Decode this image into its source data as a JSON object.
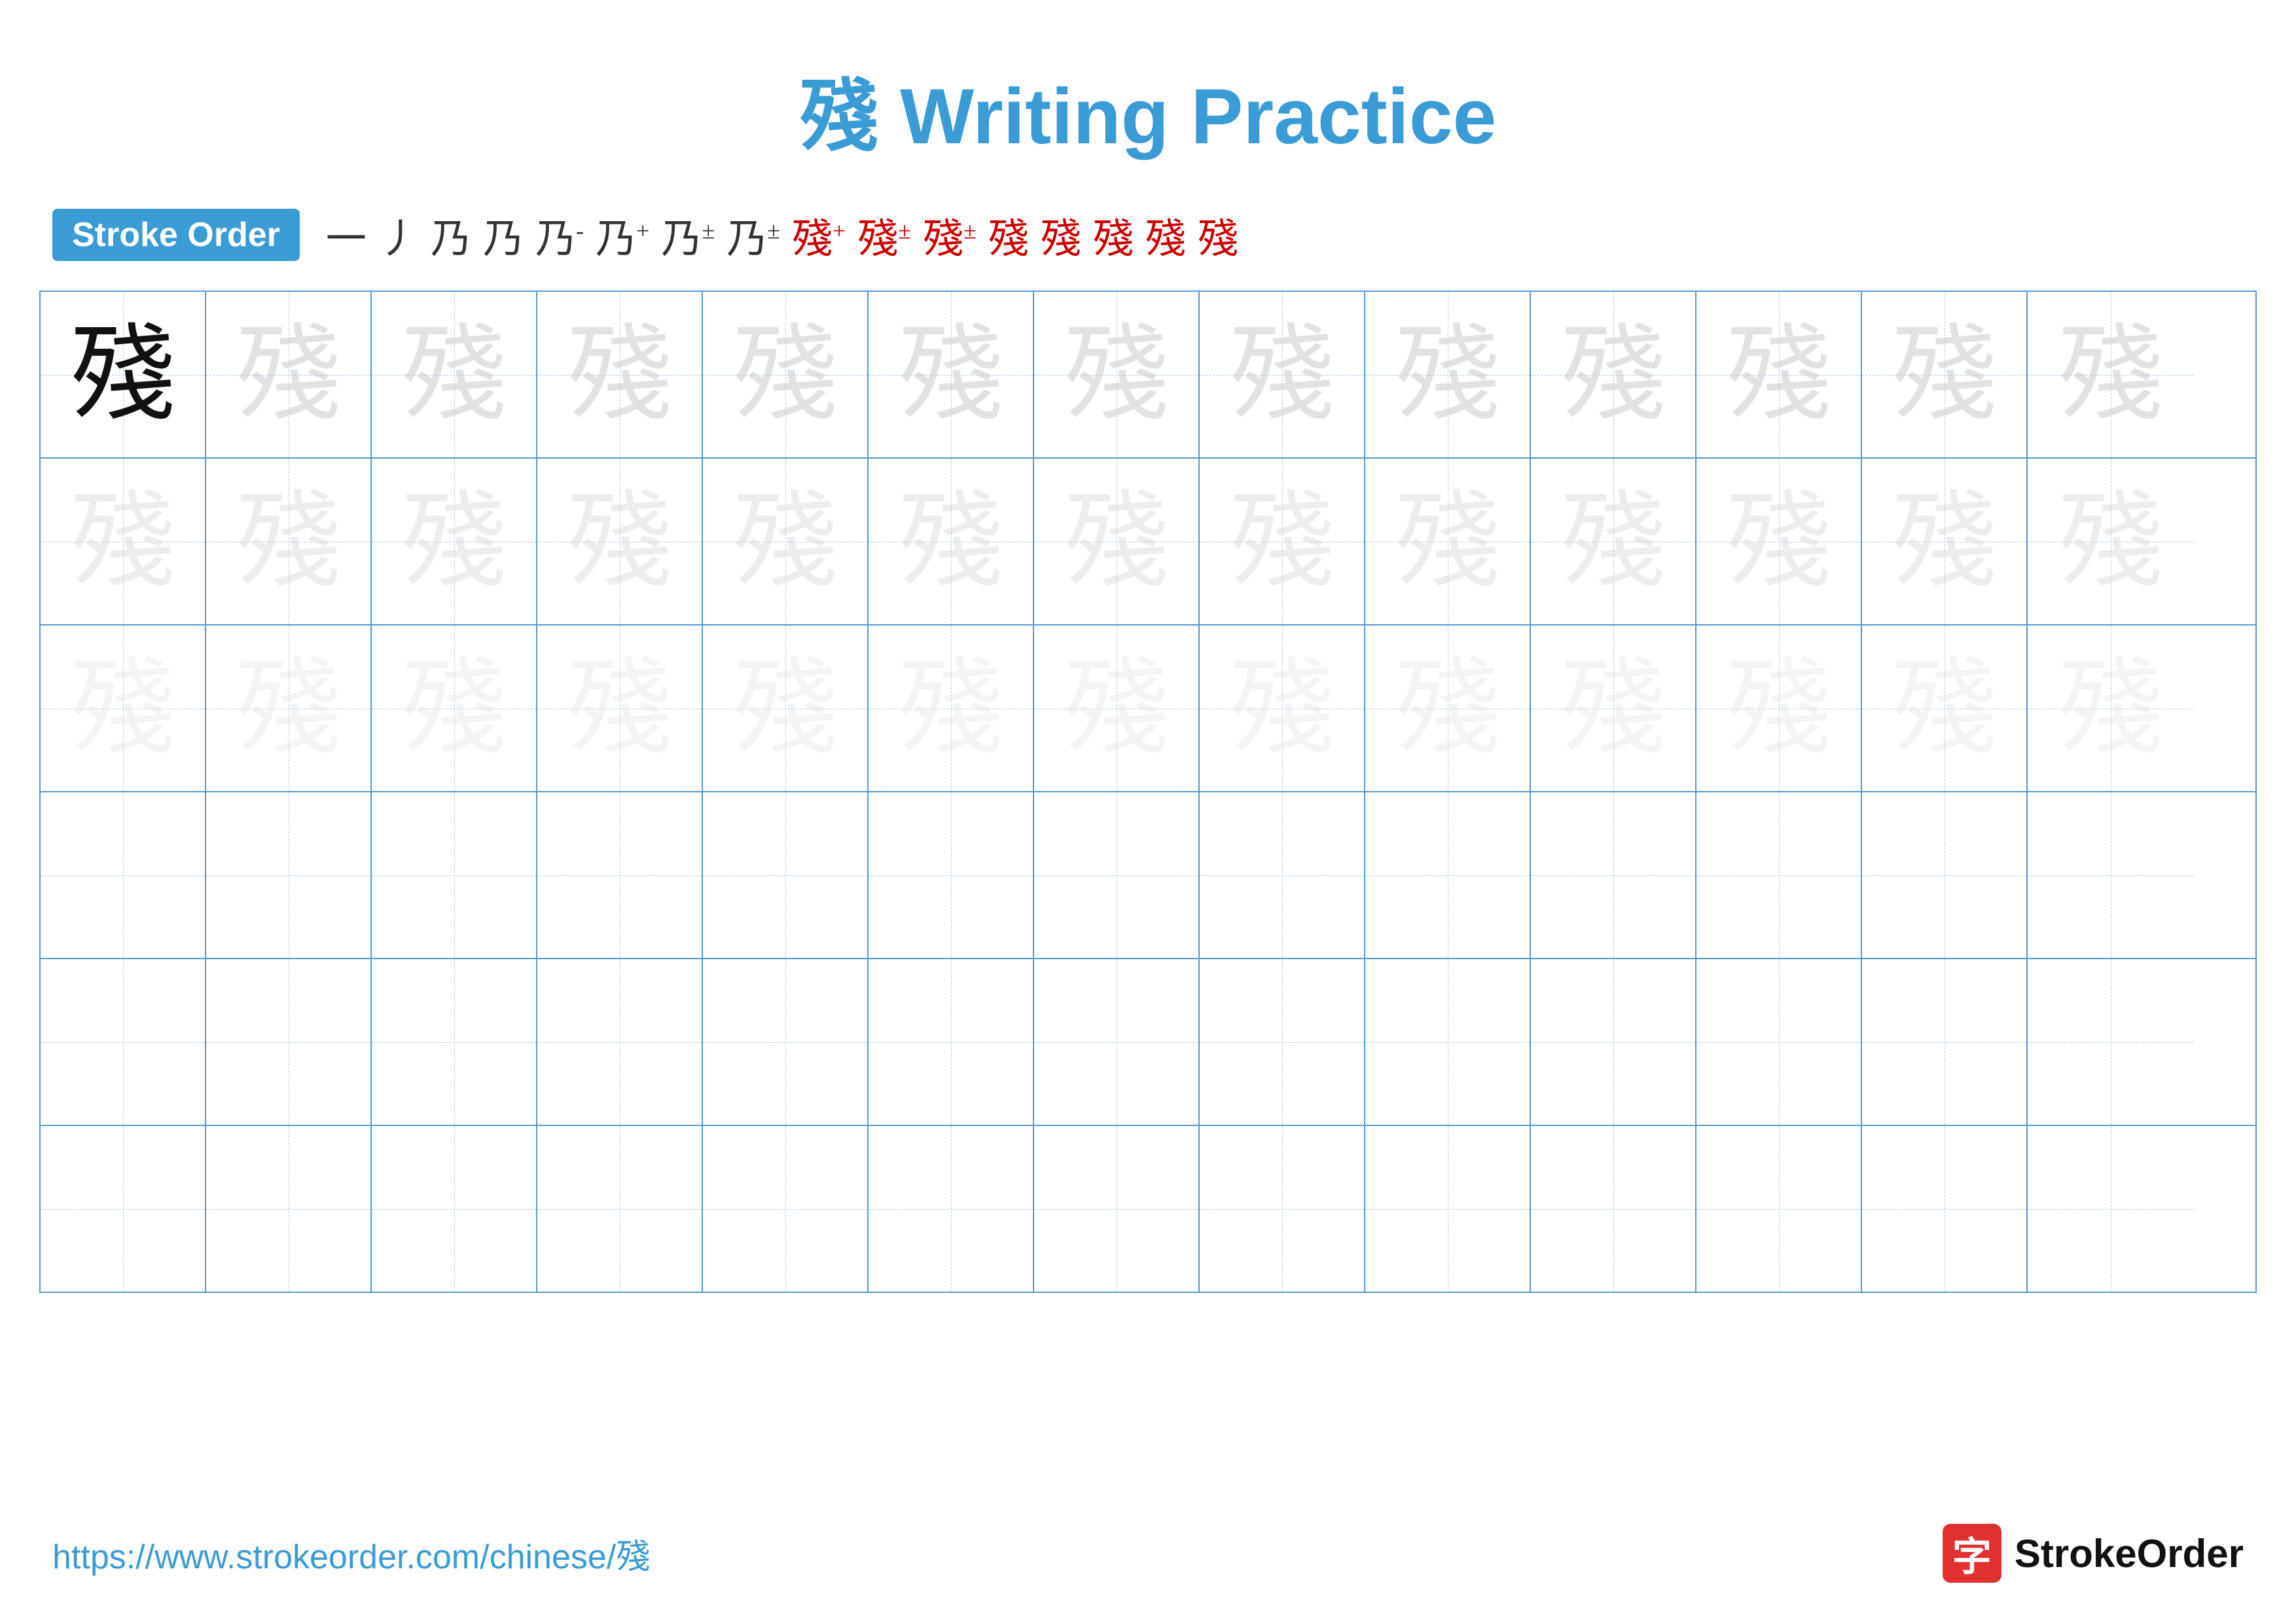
{
  "title": {
    "char": "殘",
    "text": " Writing Practice",
    "full": "殘 Writing Practice"
  },
  "stroke_order": {
    "badge_label": "Stroke Order",
    "strokes": [
      "一",
      "丿",
      "乃",
      "乃",
      "乃⁻",
      "乃⁺",
      "乃±",
      "乃±",
      "殘⁺",
      "殘±",
      "殘±",
      "殘",
      "殘",
      "殘",
      "殘",
      "殘"
    ]
  },
  "grid": {
    "rows": 6,
    "cols": 13,
    "character": "殘"
  },
  "footer": {
    "url": "https://www.strokeorder.com/chinese/殘",
    "logo_char": "字",
    "logo_text": "StrokeOrder"
  }
}
